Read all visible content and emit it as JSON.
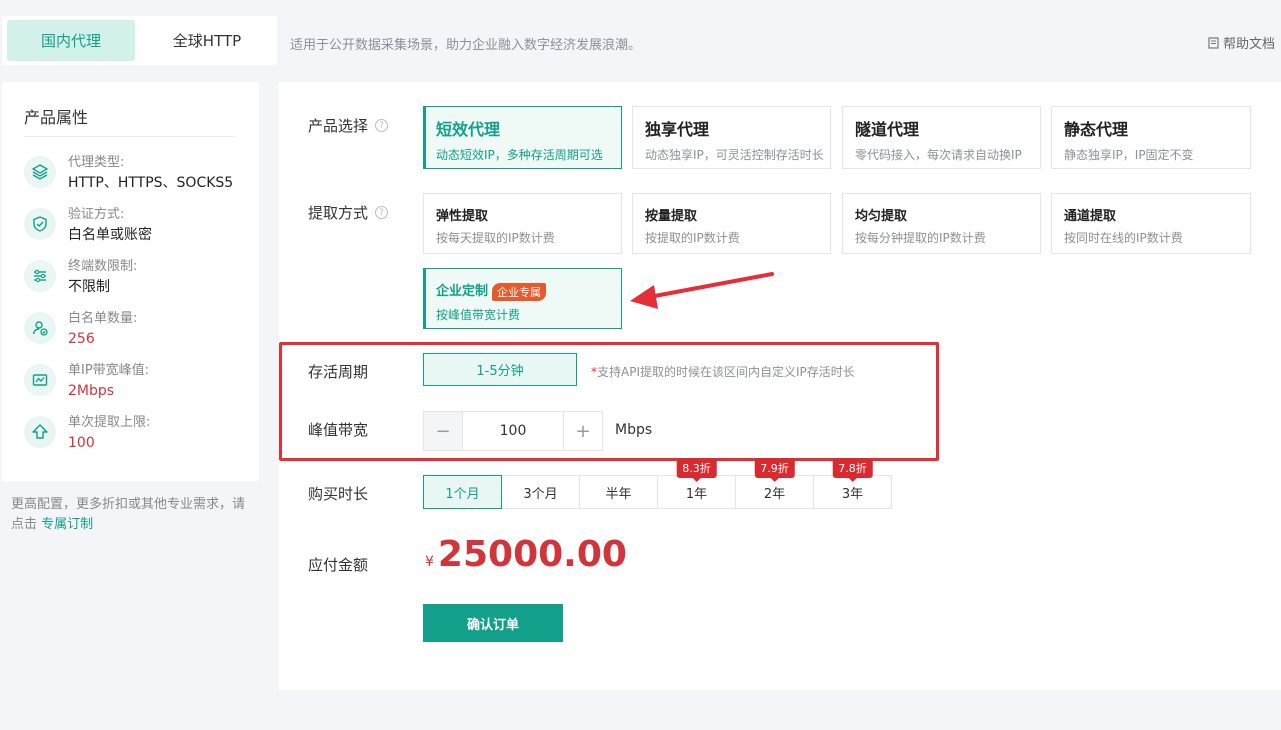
{
  "tabs": [
    {
      "label": "国内代理",
      "active": true
    },
    {
      "label": "全球HTTP",
      "active": false
    }
  ],
  "top_desc": "适用于公开数据采集场景，助力企业融入数字经济发展浪潮。",
  "help_label": "帮助文档",
  "attributes": {
    "title": "产品属性",
    "items": [
      {
        "icon": "layers-icon",
        "label": "代理类型:",
        "value": "HTTP、HTTPS、SOCKS5"
      },
      {
        "icon": "shield-check-icon",
        "label": "验证方式:",
        "value": "白名单或账密"
      },
      {
        "icon": "sliders-icon",
        "label": "终端数限制:",
        "value": "不限制"
      },
      {
        "icon": "user-check-icon",
        "label": "白名单数量:",
        "value": "256"
      },
      {
        "icon": "bandwidth-icon",
        "label": "单IP带宽峰值:",
        "value": "2Mbps"
      },
      {
        "icon": "upload-limit-icon",
        "label": "单次提取上限:",
        "value": "100"
      }
    ]
  },
  "left_note": {
    "text": "更高配置，更多折扣或其他专业需求，请点击",
    "link": "专属订制"
  },
  "product_select": {
    "label": "产品选择",
    "options": [
      {
        "title": "短效代理",
        "sub": "动态短效IP，多种存活周期可选",
        "active": true
      },
      {
        "title": "独享代理",
        "sub": "动态独享IP，可灵活控制存活时长",
        "active": false
      },
      {
        "title": "隧道代理",
        "sub": "零代码接入，每次请求自动换IP",
        "active": false
      },
      {
        "title": "静态代理",
        "sub": "静态独享IP，IP固定不变",
        "active": false
      }
    ]
  },
  "extract_method": {
    "label": "提取方式",
    "options": [
      {
        "title": "弹性提取",
        "sub": "按每天提取的IP数计费",
        "active": false
      },
      {
        "title": "按量提取",
        "sub": "按提取的IP数计费",
        "active": false
      },
      {
        "title": "均匀提取",
        "sub": "按每分钟提取的IP数计费",
        "active": false
      },
      {
        "title": "通道提取",
        "sub": "按同时在线的IP数计费",
        "active": false
      },
      {
        "title": "企业定制",
        "badge": "企业专属",
        "sub": "按峰值带宽计费",
        "active": true
      }
    ]
  },
  "survive": {
    "label": "存活周期",
    "value": "1-5分钟",
    "note_star": "*",
    "note": "支持API提取的时候在该区间内自定义IP存活时长"
  },
  "bandwidth": {
    "label": "峰值带宽",
    "minus": "−",
    "plus": "+",
    "value": "100",
    "unit": "Mbps"
  },
  "duration": {
    "label": "购买时长",
    "options": [
      {
        "label": "1个月",
        "discount": "",
        "active": true
      },
      {
        "label": "3个月",
        "discount": "",
        "active": false
      },
      {
        "label": "半年",
        "discount": "",
        "active": false
      },
      {
        "label": "1年",
        "discount": "8.3折",
        "active": false
      },
      {
        "label": "2年",
        "discount": "7.9折",
        "active": false
      },
      {
        "label": "3年",
        "discount": "7.8折",
        "active": false
      }
    ]
  },
  "payment": {
    "label": "应付金额",
    "currency": "¥",
    "amount": "25000.00"
  },
  "confirm_label": "确认订单",
  "colors": {
    "accent": "#13a08a",
    "price": "#d1343b",
    "highlight": "#e62e37"
  }
}
